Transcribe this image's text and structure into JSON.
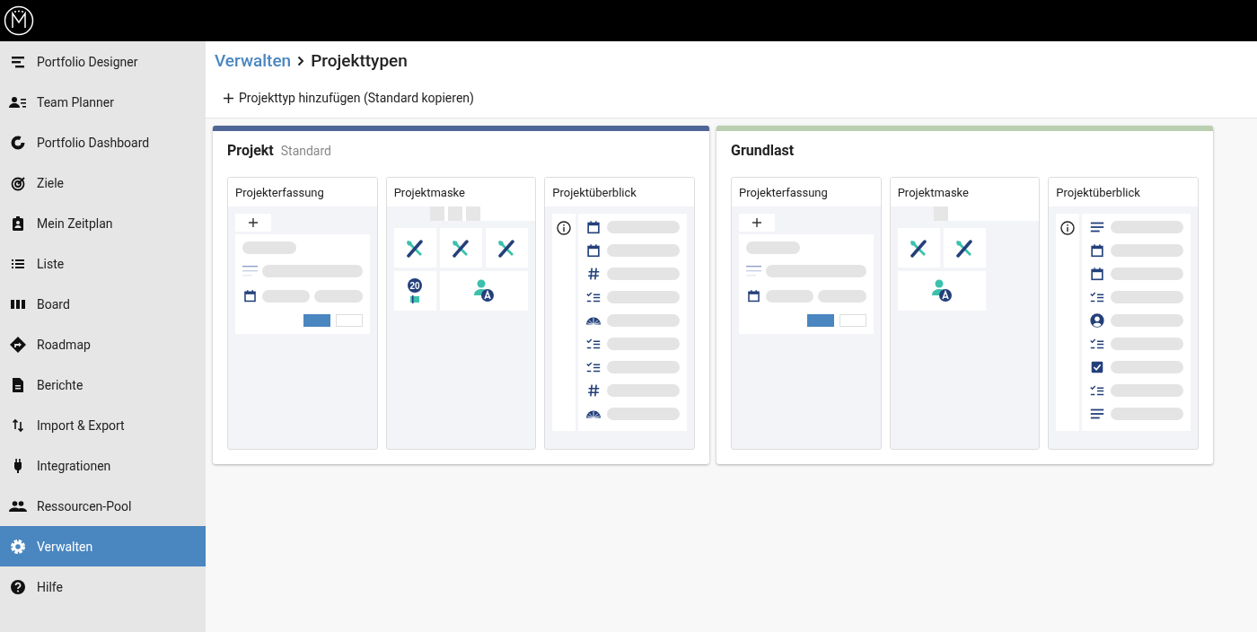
{
  "sidebar": {
    "items": [
      {
        "label": "Portfolio Designer",
        "kind": "designer",
        "selected": false
      },
      {
        "label": "Team Planner",
        "kind": "team",
        "selected": false
      },
      {
        "label": "Portfolio Dashboard",
        "kind": "donut",
        "selected": false
      },
      {
        "label": "Ziele",
        "kind": "target",
        "selected": false
      },
      {
        "label": "Mein Zeitplan",
        "kind": "badge",
        "selected": false
      },
      {
        "label": "Liste",
        "kind": "list",
        "selected": false
      },
      {
        "label": "Board",
        "kind": "board",
        "selected": false
      },
      {
        "label": "Roadmap",
        "kind": "roadmap",
        "selected": false
      },
      {
        "label": "Berichte",
        "kind": "report",
        "selected": false
      },
      {
        "label": "Import & Export",
        "kind": "import",
        "selected": false
      },
      {
        "label": "Integrationen",
        "kind": "plug",
        "selected": false
      },
      {
        "label": "Ressourcen-Pool",
        "kind": "people",
        "selected": false
      },
      {
        "label": "Verwalten",
        "kind": "gear",
        "selected": true
      },
      {
        "label": "Hilfe",
        "kind": "help",
        "selected": false
      }
    ]
  },
  "breadcrumb": [
    {
      "label": "Verwalten",
      "kind": "link"
    },
    {
      "label": "Projekttypen",
      "kind": "current"
    }
  ],
  "add_button": {
    "label": "Projekttyp hinzufügen (Standard kopieren)"
  },
  "project_types": [
    {
      "name": "Projekt",
      "badge": "Standard",
      "color": "#4f6496",
      "capture": {
        "title": "Projekterfassung"
      },
      "mask": {
        "title": "Projektmaske",
        "tabs": [
          {
            "kind": "tab"
          },
          {
            "kind": "tab"
          },
          {
            "kind": "tab"
          }
        ],
        "tiles": [
          {
            "kind": "tools"
          },
          {
            "kind": "tools"
          },
          {
            "kind": "tools"
          },
          {
            "kind": "date-badge",
            "label": "20"
          },
          {
            "kind": "assignee"
          }
        ]
      },
      "overview": {
        "title": "Projektüberblick",
        "fields": [
          {
            "kind": "date"
          },
          {
            "kind": "date"
          },
          {
            "kind": "number"
          },
          {
            "kind": "checklist"
          },
          {
            "kind": "gauge"
          },
          {
            "kind": "checklist"
          },
          {
            "kind": "checklist"
          },
          {
            "kind": "number"
          },
          {
            "kind": "gauge"
          }
        ]
      }
    },
    {
      "name": "Grundlast",
      "color": "#b9cfb0",
      "capture": {
        "title": "Projekterfassung"
      },
      "mask": {
        "title": "Projektmaske",
        "tabs": [
          {
            "kind": "tab"
          }
        ],
        "tiles": [
          {
            "kind": "tools"
          },
          {
            "kind": "tools"
          },
          {
            "kind": "assignee"
          }
        ]
      },
      "overview": {
        "title": "Projektüberblick",
        "fields": [
          {
            "kind": "text"
          },
          {
            "kind": "date"
          },
          {
            "kind": "date"
          },
          {
            "kind": "checklist"
          },
          {
            "kind": "person"
          },
          {
            "kind": "checklist"
          },
          {
            "kind": "checkbox"
          },
          {
            "kind": "checklist"
          },
          {
            "kind": "text"
          }
        ]
      }
    }
  ]
}
